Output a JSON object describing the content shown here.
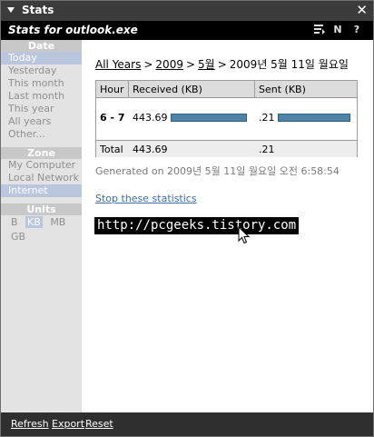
{
  "titlebar": {
    "title": "Stats",
    "close_glyph": "✕"
  },
  "subheader": {
    "title": "Stats for outlook.exe",
    "icons": [
      "list-icon",
      "n-icon",
      "help-icon"
    ],
    "n_label": "N",
    "help_label": "?"
  },
  "sidebar": {
    "date": {
      "header": "Date",
      "items": [
        "Today",
        "Yesterday",
        "This month",
        "Last month",
        "This year",
        "All years",
        "Other..."
      ],
      "selected": "Today"
    },
    "zone": {
      "header": "Zone",
      "items": [
        "My Computer",
        "Local Network",
        "Internet"
      ],
      "selected": "Internet"
    },
    "units": {
      "header": "Units",
      "items": [
        "B",
        "KB",
        "MB",
        "GB"
      ],
      "selected": "KB"
    }
  },
  "breadcrumb": {
    "all_years": "All Years",
    "sep": ">",
    "year": "2009",
    "month": "5월",
    "current": "2009년 5월 11일 월요일"
  },
  "table": {
    "headers": [
      "Hour",
      "Received (KB)",
      "Sent (KB)"
    ],
    "row": {
      "hour": "6 - 7",
      "received": "443.69",
      "sent": ".21",
      "received_fill": 1.0,
      "sent_fill": 1.0
    },
    "total": {
      "label": "Total",
      "received": "443.69",
      "sent": ".21"
    }
  },
  "generated": "Generated on 2009년 5월 11일 월요일 오전 6:58:54",
  "stop_link": "Stop these statistics",
  "watermark": "http://pcgeeks.tistory.com",
  "footer": {
    "refresh": "Refresh",
    "export": "Export",
    "reset": "Reset"
  },
  "colors": {
    "bar": "#4e84a7",
    "selected": "#b9c6de",
    "titlebar": "#3b3b3b"
  }
}
